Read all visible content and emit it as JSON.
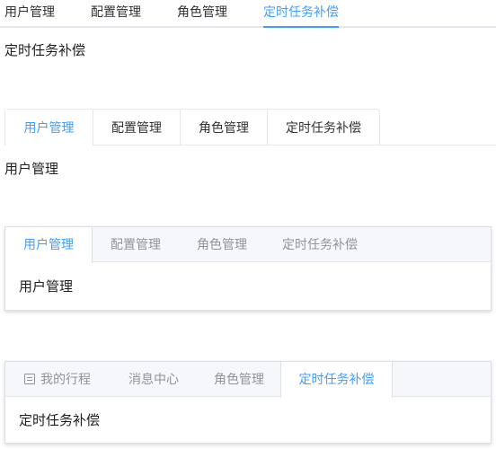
{
  "plain_tabs": {
    "tabs": [
      "用户管理",
      "配置管理",
      "角色管理",
      "定时任务补偿"
    ],
    "active_index": 3,
    "content": "定时任务补偿"
  },
  "card_tabs": {
    "tabs": [
      "用户管理",
      "配置管理",
      "角色管理",
      "定时任务补偿"
    ],
    "active_index": 0,
    "content": "用户管理"
  },
  "border_card_tabs": {
    "tabs": [
      "用户管理",
      "配置管理",
      "角色管理",
      "定时任务补偿"
    ],
    "active_index": 0,
    "content": "用户管理"
  },
  "border_card_tabs_icon": {
    "tabs": [
      {
        "label": "我的行程",
        "icon": "calendar-icon"
      },
      {
        "label": "消息中心"
      },
      {
        "label": "角色管理"
      },
      {
        "label": "定时任务补偿"
      }
    ],
    "active_index": 3,
    "content": "定时任务补偿"
  },
  "colors": {
    "accent": "#409eff",
    "text": "#303133",
    "muted_text": "#909399",
    "border": "#e4e7ed",
    "header_bg": "#f5f7fa"
  }
}
